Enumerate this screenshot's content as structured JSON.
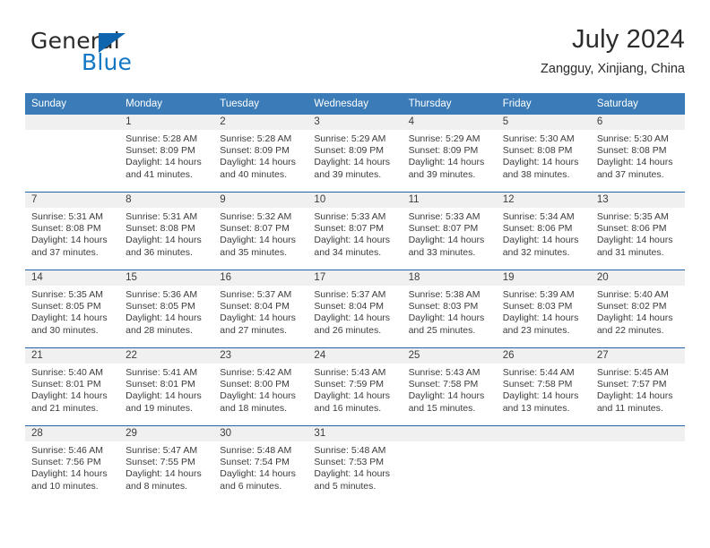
{
  "brand": {
    "name_part1": "General",
    "name_part2": "Blue",
    "triangle_icon": "triangle-icon"
  },
  "header": {
    "title": "July 2024",
    "subtitle": "Zangguy, Xinjiang, China"
  },
  "colors": {
    "header_blue": "#3b7cb8",
    "separator_blue": "#1f63a8",
    "daynum_band": "#f0f0f0",
    "logo_blue": "#1277c4",
    "text": "#3c3c3c"
  },
  "weekday_headers": [
    "Sunday",
    "Monday",
    "Tuesday",
    "Wednesday",
    "Thursday",
    "Friday",
    "Saturday"
  ],
  "weeks": [
    [
      {
        "day": "",
        "sunrise": "",
        "sunset": "",
        "daylight_line1": "",
        "daylight_line2": ""
      },
      {
        "day": "1",
        "sunrise": "Sunrise: 5:28 AM",
        "sunset": "Sunset: 8:09 PM",
        "daylight_line1": "Daylight: 14 hours",
        "daylight_line2": "and 41 minutes."
      },
      {
        "day": "2",
        "sunrise": "Sunrise: 5:28 AM",
        "sunset": "Sunset: 8:09 PM",
        "daylight_line1": "Daylight: 14 hours",
        "daylight_line2": "and 40 minutes."
      },
      {
        "day": "3",
        "sunrise": "Sunrise: 5:29 AM",
        "sunset": "Sunset: 8:09 PM",
        "daylight_line1": "Daylight: 14 hours",
        "daylight_line2": "and 39 minutes."
      },
      {
        "day": "4",
        "sunrise": "Sunrise: 5:29 AM",
        "sunset": "Sunset: 8:09 PM",
        "daylight_line1": "Daylight: 14 hours",
        "daylight_line2": "and 39 minutes."
      },
      {
        "day": "5",
        "sunrise": "Sunrise: 5:30 AM",
        "sunset": "Sunset: 8:08 PM",
        "daylight_line1": "Daylight: 14 hours",
        "daylight_line2": "and 38 minutes."
      },
      {
        "day": "6",
        "sunrise": "Sunrise: 5:30 AM",
        "sunset": "Sunset: 8:08 PM",
        "daylight_line1": "Daylight: 14 hours",
        "daylight_line2": "and 37 minutes."
      }
    ],
    [
      {
        "day": "7",
        "sunrise": "Sunrise: 5:31 AM",
        "sunset": "Sunset: 8:08 PM",
        "daylight_line1": "Daylight: 14 hours",
        "daylight_line2": "and 37 minutes."
      },
      {
        "day": "8",
        "sunrise": "Sunrise: 5:31 AM",
        "sunset": "Sunset: 8:08 PM",
        "daylight_line1": "Daylight: 14 hours",
        "daylight_line2": "and 36 minutes."
      },
      {
        "day": "9",
        "sunrise": "Sunrise: 5:32 AM",
        "sunset": "Sunset: 8:07 PM",
        "daylight_line1": "Daylight: 14 hours",
        "daylight_line2": "and 35 minutes."
      },
      {
        "day": "10",
        "sunrise": "Sunrise: 5:33 AM",
        "sunset": "Sunset: 8:07 PM",
        "daylight_line1": "Daylight: 14 hours",
        "daylight_line2": "and 34 minutes."
      },
      {
        "day": "11",
        "sunrise": "Sunrise: 5:33 AM",
        "sunset": "Sunset: 8:07 PM",
        "daylight_line1": "Daylight: 14 hours",
        "daylight_line2": "and 33 minutes."
      },
      {
        "day": "12",
        "sunrise": "Sunrise: 5:34 AM",
        "sunset": "Sunset: 8:06 PM",
        "daylight_line1": "Daylight: 14 hours",
        "daylight_line2": "and 32 minutes."
      },
      {
        "day": "13",
        "sunrise": "Sunrise: 5:35 AM",
        "sunset": "Sunset: 8:06 PM",
        "daylight_line1": "Daylight: 14 hours",
        "daylight_line2": "and 31 minutes."
      }
    ],
    [
      {
        "day": "14",
        "sunrise": "Sunrise: 5:35 AM",
        "sunset": "Sunset: 8:05 PM",
        "daylight_line1": "Daylight: 14 hours",
        "daylight_line2": "and 30 minutes."
      },
      {
        "day": "15",
        "sunrise": "Sunrise: 5:36 AM",
        "sunset": "Sunset: 8:05 PM",
        "daylight_line1": "Daylight: 14 hours",
        "daylight_line2": "and 28 minutes."
      },
      {
        "day": "16",
        "sunrise": "Sunrise: 5:37 AM",
        "sunset": "Sunset: 8:04 PM",
        "daylight_line1": "Daylight: 14 hours",
        "daylight_line2": "and 27 minutes."
      },
      {
        "day": "17",
        "sunrise": "Sunrise: 5:37 AM",
        "sunset": "Sunset: 8:04 PM",
        "daylight_line1": "Daylight: 14 hours",
        "daylight_line2": "and 26 minutes."
      },
      {
        "day": "18",
        "sunrise": "Sunrise: 5:38 AM",
        "sunset": "Sunset: 8:03 PM",
        "daylight_line1": "Daylight: 14 hours",
        "daylight_line2": "and 25 minutes."
      },
      {
        "day": "19",
        "sunrise": "Sunrise: 5:39 AM",
        "sunset": "Sunset: 8:03 PM",
        "daylight_line1": "Daylight: 14 hours",
        "daylight_line2": "and 23 minutes."
      },
      {
        "day": "20",
        "sunrise": "Sunrise: 5:40 AM",
        "sunset": "Sunset: 8:02 PM",
        "daylight_line1": "Daylight: 14 hours",
        "daylight_line2": "and 22 minutes."
      }
    ],
    [
      {
        "day": "21",
        "sunrise": "Sunrise: 5:40 AM",
        "sunset": "Sunset: 8:01 PM",
        "daylight_line1": "Daylight: 14 hours",
        "daylight_line2": "and 21 minutes."
      },
      {
        "day": "22",
        "sunrise": "Sunrise: 5:41 AM",
        "sunset": "Sunset: 8:01 PM",
        "daylight_line1": "Daylight: 14 hours",
        "daylight_line2": "and 19 minutes."
      },
      {
        "day": "23",
        "sunrise": "Sunrise: 5:42 AM",
        "sunset": "Sunset: 8:00 PM",
        "daylight_line1": "Daylight: 14 hours",
        "daylight_line2": "and 18 minutes."
      },
      {
        "day": "24",
        "sunrise": "Sunrise: 5:43 AM",
        "sunset": "Sunset: 7:59 PM",
        "daylight_line1": "Daylight: 14 hours",
        "daylight_line2": "and 16 minutes."
      },
      {
        "day": "25",
        "sunrise": "Sunrise: 5:43 AM",
        "sunset": "Sunset: 7:58 PM",
        "daylight_line1": "Daylight: 14 hours",
        "daylight_line2": "and 15 minutes."
      },
      {
        "day": "26",
        "sunrise": "Sunrise: 5:44 AM",
        "sunset": "Sunset: 7:58 PM",
        "daylight_line1": "Daylight: 14 hours",
        "daylight_line2": "and 13 minutes."
      },
      {
        "day": "27",
        "sunrise": "Sunrise: 5:45 AM",
        "sunset": "Sunset: 7:57 PM",
        "daylight_line1": "Daylight: 14 hours",
        "daylight_line2": "and 11 minutes."
      }
    ],
    [
      {
        "day": "28",
        "sunrise": "Sunrise: 5:46 AM",
        "sunset": "Sunset: 7:56 PM",
        "daylight_line1": "Daylight: 14 hours",
        "daylight_line2": "and 10 minutes."
      },
      {
        "day": "29",
        "sunrise": "Sunrise: 5:47 AM",
        "sunset": "Sunset: 7:55 PM",
        "daylight_line1": "Daylight: 14 hours",
        "daylight_line2": "and 8 minutes."
      },
      {
        "day": "30",
        "sunrise": "Sunrise: 5:48 AM",
        "sunset": "Sunset: 7:54 PM",
        "daylight_line1": "Daylight: 14 hours",
        "daylight_line2": "and 6 minutes."
      },
      {
        "day": "31",
        "sunrise": "Sunrise: 5:48 AM",
        "sunset": "Sunset: 7:53 PM",
        "daylight_line1": "Daylight: 14 hours",
        "daylight_line2": "and 5 minutes."
      },
      {
        "day": "",
        "sunrise": "",
        "sunset": "",
        "daylight_line1": "",
        "daylight_line2": ""
      },
      {
        "day": "",
        "sunrise": "",
        "sunset": "",
        "daylight_line1": "",
        "daylight_line2": ""
      },
      {
        "day": "",
        "sunrise": "",
        "sunset": "",
        "daylight_line1": "",
        "daylight_line2": ""
      }
    ]
  ]
}
